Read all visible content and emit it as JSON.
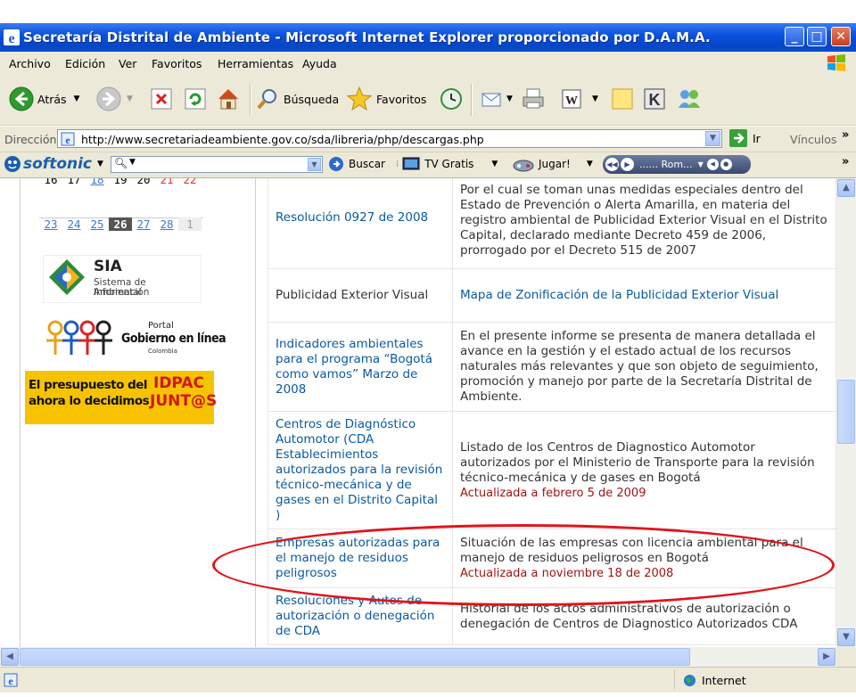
{
  "window": {
    "title": "Secretaría Distrital de Ambiente - Microsoft Internet Explorer proporcionado por D.A.M.A.",
    "buttons": {
      "minimize": "_",
      "maximize": "□",
      "close": "✕"
    }
  },
  "menu": [
    "Archivo",
    "Edición",
    "Ver",
    "Favoritos",
    "Herramientas",
    "Ayuda"
  ],
  "toolbar": {
    "back_label": "Atrás",
    "search_label": "Búsqueda",
    "favorites_label": "Favoritos"
  },
  "address": {
    "label": "Dirección",
    "url": "http://www.secretariadeambiente.gov.co/sda/libreria/php/descargas.php",
    "go_label": "Ir",
    "links_label": "Vínculos"
  },
  "softonic": {
    "brand": "softonic",
    "search_placeholder": "",
    "search_button": "Buscar",
    "tv_label": "TV Gratis",
    "play_label": "Jugar!",
    "media_label": "...... Rom..."
  },
  "calendar": {
    "row1": [
      "16",
      "17",
      "18",
      "19",
      "20",
      "21",
      "22"
    ],
    "row2": [
      "23",
      "24",
      "25",
      "26",
      "27",
      "28",
      "1"
    ]
  },
  "sidebar": {
    "sia_title": "SIA",
    "sia_sub1": "Sistema de Información",
    "sia_sub2": "Ambiental",
    "portal_label": "Portal",
    "gobierno_label": "Gobierno en línea",
    "colombia_label": "Colombia",
    "idpac_line1": "El presupuesto del",
    "idpac_line2": "ahora lo decidimos",
    "idpac_brand1": "IDPAC",
    "idpac_brand2": "JUNT@S"
  },
  "table": [
    {
      "left": "Resolución 0927 de 2008",
      "left_link": true,
      "right": "Por el cual se toman unas medidas especiales dentro del Estado de Prevención o Alerta Amarilla, en materia del registro ambiental de Publicidad Exterior Visual en el Distrito Capital, declarado mediante Decreto 459 de 2006, prorrogado por el Decreto 515 de 2007",
      "right_link": false,
      "updated": ""
    },
    {
      "left": "Publicidad Exterior Visual",
      "left_link": false,
      "right": "Mapa de Zonificación de la Publicidad Exterior Visual",
      "right_link": true,
      "updated": ""
    },
    {
      "left": "Indicadores ambientales para el programa “Bogotá como vamos” Marzo de 2008",
      "left_link": true,
      "right": "En el presente informe se presenta de manera detallada el avance en la gestión y el estado actual de los recursos naturales más relevantes y que son objeto de seguimiento, promoción y manejo por parte de la Secretaría Distrital de Ambiente.",
      "right_link": false,
      "updated": ""
    },
    {
      "left": "Centros de Diagnóstico Automotor (CDA Establecimientos autorizados para la revisión técnico-mecánica y de gases en el Distrito Capital )",
      "left_link": true,
      "right": "Listado de los Centros de Diagnostico Automotor autorizados por el Ministerio de Transporte para la revisión técnico-mecánica y de gases en Bogotá",
      "right_link": false,
      "updated": "Actualizada a febrero 5 de 2009"
    },
    {
      "left": "Empresas autorizadas para el manejo de residuos peligrosos",
      "left_link": true,
      "right": "Situación de las empresas con licencia ambiental para el manejo de residuos peligrosos en Bogotá",
      "right_link": false,
      "updated": "Actualizada a noviembre 18 de 2008"
    },
    {
      "left": "Resoluciones y Autos de autorización o denegación de CDA",
      "left_link": true,
      "right": "Historial de los actos administrativos de autorización o denegación de Centros de Diagnostico Autorizados CDA",
      "right_link": false,
      "updated": ""
    }
  ],
  "status": {
    "zone": "Internet"
  }
}
